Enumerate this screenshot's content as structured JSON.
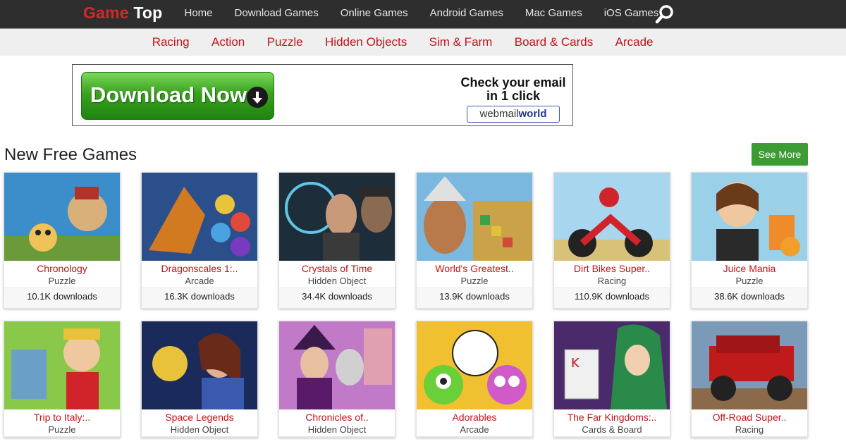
{
  "header": {
    "logo_part1": "Game",
    "logo_part2": "Top",
    "nav": [
      "Home",
      "Download Games",
      "Online Games",
      "Android Games",
      "Mac Games",
      "iOS Games"
    ],
    "search_icon": "search-icon"
  },
  "categories": [
    "Racing",
    "Action",
    "Puzzle",
    "Hidden Objects",
    "Sim & Farm",
    "Board & Cards",
    "Arcade"
  ],
  "banner": {
    "download_label": "Download Now",
    "headline_line1": "Check your email",
    "headline_line2": "in 1 click",
    "logo_text_a": "webmail",
    "logo_text_b": "world"
  },
  "section": {
    "title": "New Free Games",
    "see_more": "See More"
  },
  "colors": {
    "accent_red": "#c0141a",
    "topbar": "#2e2e2e",
    "button_green": "#3c9b32"
  },
  "games": [
    {
      "title": "Chronology",
      "genre": "Puzzle",
      "downloads": "10.1K downloads"
    },
    {
      "title": "Dragonscales 1:..",
      "genre": "Arcade",
      "downloads": "16.3K downloads"
    },
    {
      "title": "Crystals of Time",
      "genre": "Hidden Object",
      "downloads": "34.4K downloads"
    },
    {
      "title": "World's Greatest..",
      "genre": "Puzzle",
      "downloads": "13.9K downloads"
    },
    {
      "title": "Dirt Bikes Super..",
      "genre": "Racing",
      "downloads": "110.9K downloads"
    },
    {
      "title": "Juice Mania",
      "genre": "Puzzle",
      "downloads": "38.6K downloads"
    },
    {
      "title": "Trip to Italy:..",
      "genre": "Puzzle",
      "downloads": ""
    },
    {
      "title": "Space Legends",
      "genre": "Hidden Object",
      "downloads": ""
    },
    {
      "title": "Chronicles of..",
      "genre": "Hidden Object",
      "downloads": ""
    },
    {
      "title": "Adorables",
      "genre": "Arcade",
      "downloads": ""
    },
    {
      "title": "The Far Kingdoms:..",
      "genre": "Cards & Board",
      "downloads": ""
    },
    {
      "title": "Off-Road Super..",
      "genre": "Racing",
      "downloads": ""
    }
  ]
}
